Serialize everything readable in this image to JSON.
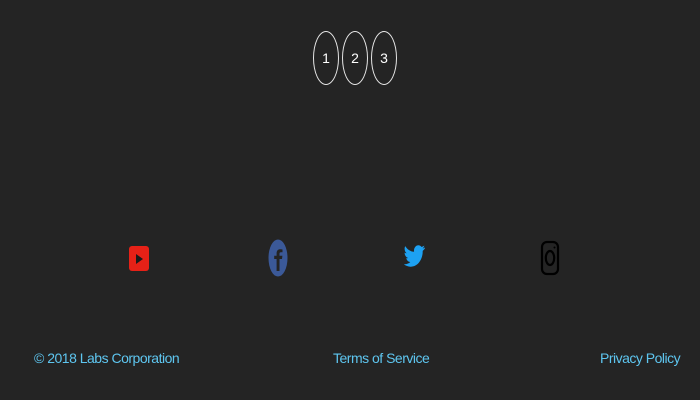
{
  "pagination": {
    "pages": [
      "1",
      "2",
      "3"
    ]
  },
  "social": {
    "icons": [
      {
        "name": "youtube-icon",
        "color": "#e62117"
      },
      {
        "name": "facebook-icon",
        "color": "#3b5998"
      },
      {
        "name": "twitter-icon",
        "color": "#1da1f2"
      },
      {
        "name": "instagram-icon",
        "color": "#000000"
      }
    ]
  },
  "footer": {
    "copyright": "© 2018 Labs Corporation",
    "terms": "Terms of Service",
    "privacy": "Privacy Policy",
    "link_color": "#5ec6f0"
  },
  "colors": {
    "background": "#242424"
  }
}
